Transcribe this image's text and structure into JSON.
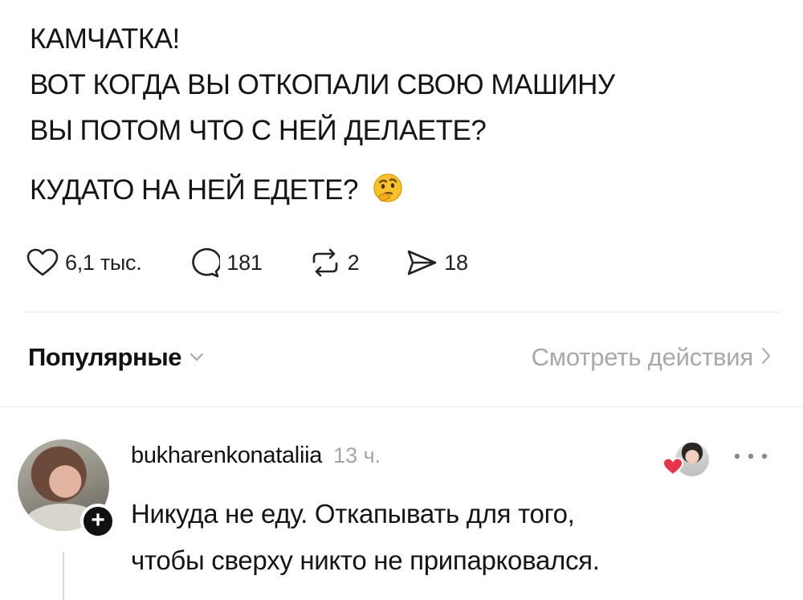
{
  "post": {
    "lines": [
      "КАМЧАТКА!",
      "ВОТ КОГДА ВЫ ОТКОПАЛИ СВОЮ МАШИНУ",
      "ВЫ ПОТОМ ЧТО С НЕЙ ДЕЛАЕТЕ?",
      "КУДАТО НА НЕЙ ЕДЕТЕ?"
    ],
    "emoji": "thinking-face-icon"
  },
  "actions": {
    "likes": "6,1 тыс.",
    "comments": "181",
    "reposts": "2",
    "shares": "18",
    "icons": [
      "heart-icon",
      "comment-bubble-icon",
      "repost-icon",
      "share-icon"
    ]
  },
  "replies_header": {
    "sort_label": "Популярные",
    "view_activity_label": "Смотреть действия"
  },
  "comment": {
    "username": "bukharenkonataliia",
    "time": "13 ч.",
    "text_lines": [
      "Никуда не еду. Откапывать для того,",
      "чтобы сверху никто не припарковался."
    ],
    "follow_badge": "+",
    "liked_by_author_heart_color": "#e8334a"
  }
}
